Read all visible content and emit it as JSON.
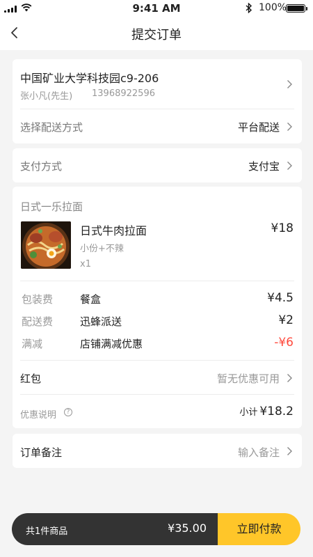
{
  "status_bar": {
    "time": "9:41 AM",
    "battery": "100%"
  },
  "nav": {
    "title": "提交订单"
  },
  "address": {
    "line": "中国矿业大学科技园c9-206",
    "name": "张小凡(先生)",
    "phone": "13968922596",
    "delivery_label": "选择配送方式",
    "delivery_value": "平台配送"
  },
  "payment": {
    "label": "支付方式",
    "value": "支付宝"
  },
  "order": {
    "shop": "日式一乐拉面",
    "item": {
      "name": "日式牛肉拉面",
      "spec": "小份+不辣",
      "qty": "x1",
      "price": "¥18"
    },
    "fees": [
      {
        "label": "包装费",
        "name": "餐盒",
        "amount": "¥4.5"
      },
      {
        "label": "配送费",
        "name": "迅蜂派送",
        "amount": "¥2"
      },
      {
        "label": "满减",
        "name": "店铺满减优惠",
        "amount": "-¥6"
      }
    ],
    "red_packet_label": "红包",
    "red_packet_value": "暂无优惠可用",
    "discount_note": "优惠说明",
    "help_glyph": "?",
    "subtotal_label": "小计",
    "subtotal_value": "¥18.2"
  },
  "remark": {
    "label": "订单备注",
    "placeholder": "输入备注"
  },
  "pay_bar": {
    "count": "共1件商品",
    "total": "¥35.00",
    "button": "立即付款"
  },
  "colors": {
    "accent": "#ffc629",
    "discount": "#ff4a3d",
    "pay_bar_dark": "#333333"
  }
}
